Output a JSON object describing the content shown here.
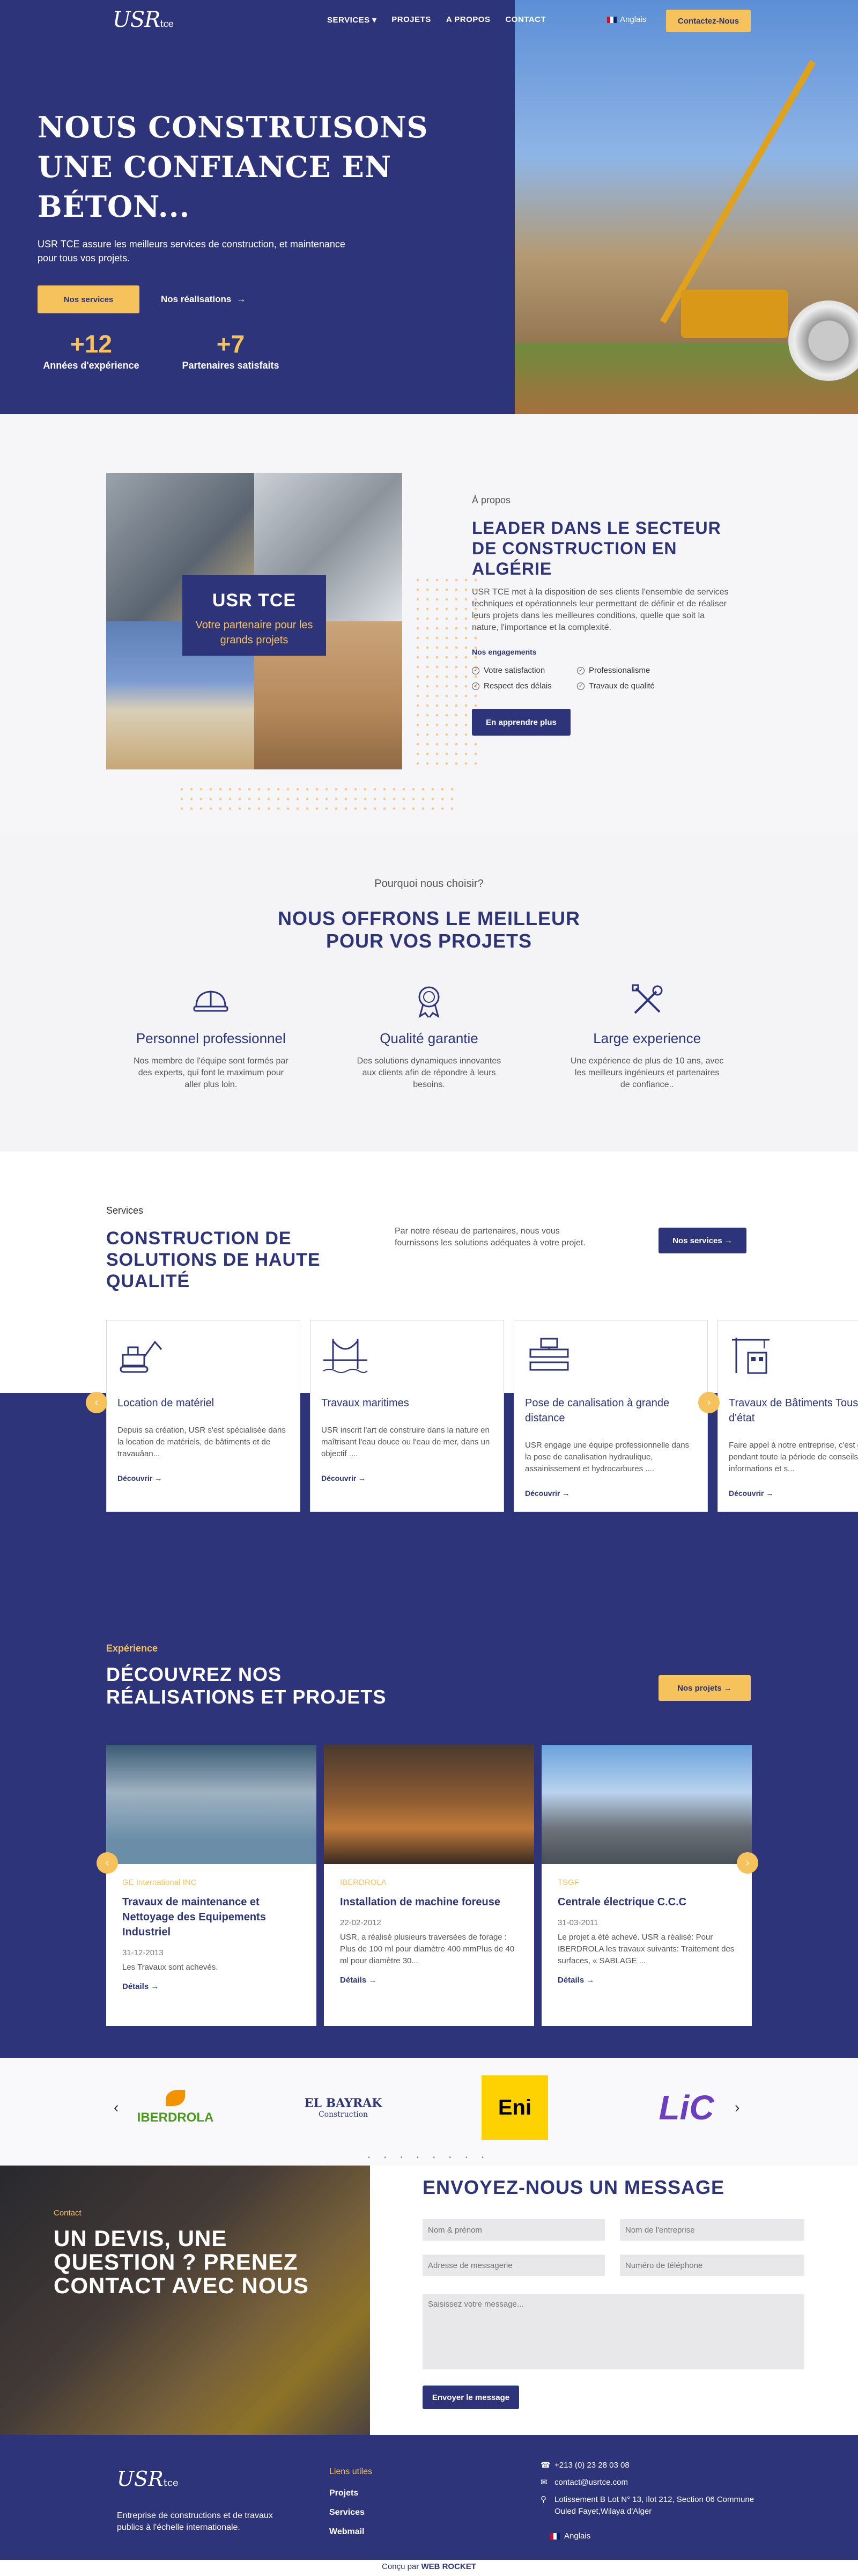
{
  "nav": {
    "logo": "USR",
    "logo_suffix": "tce",
    "items": [
      "SERVICES",
      "PROJETS",
      "A PROPOS",
      "CONTACT"
    ],
    "dropdown_arrow": "▾",
    "language": "Anglais",
    "cta": "Contactez-Nous"
  },
  "hero": {
    "title_line1": "NOUS CONSTRUISONS",
    "title_line2": "UNE CONFIANCE EN BÉTON...",
    "subtitle": "USR TCE assure les meilleurs services de construction, et maintenance pour tous vos projets.",
    "btn_services": "Nos services",
    "btn_realisations": "Nos réalisations",
    "stats": [
      {
        "value": "+12",
        "label": "Années d'expérience"
      },
      {
        "value": "+7",
        "label": "Partenaires satisfaits"
      }
    ]
  },
  "about": {
    "badge_title": "USR TCE",
    "badge_sub": "Votre partenaire pour les grands projets",
    "eyebrow": "À propos",
    "title": "LEADER DANS LE SECTEUR DE CONSTRUCTION EN ALGÉRIE",
    "text": "USR TCE met à la disposition de ses clients l'ensemble de services techniques et opérationnels leur permettant de définir et de réaliser leurs projets dans les meilleures conditions, quelle que soit la nature, l'importance et la complexité.",
    "engagements_title": "Nos engagements",
    "engagements": [
      "Votre satisfaction",
      "Professionalisme",
      "Respect des délais",
      "Travaux de qualité"
    ],
    "button": "En apprendre plus"
  },
  "why": {
    "eyebrow": "Pourquoi nous choisir?",
    "title_line1": "NOUS OFFRONS LE MEILLEUR",
    "title_line2": "POUR VOS PROJETS",
    "items": [
      {
        "title": "Personnel professionnel",
        "text": "Nos membre de l'équipe sont formés par des experts, qui font le maximum pour aller plus loin."
      },
      {
        "title": "Qualité garantie",
        "text": "Des solutions dynamiques innovantes aux clients afin de répondre à leurs besoins."
      },
      {
        "title": "Large experience",
        "text": "Une expérience de plus de 10 ans, avec les meilleurs ingénieurs et partenaires de confiance.."
      }
    ]
  },
  "services": {
    "eyebrow": "Services",
    "title": "CONSTRUCTION DE SOLUTIONS DE HAUTE QUALITÉ",
    "description": "Par notre réseau de partenaires, nous vous fournissons les solutions adéquates à votre projet.",
    "button": "Nos services",
    "cards": [
      {
        "title": "Location de matériel",
        "text": "Depuis sa création, USR s'est spécialisée dans la location de matériels, de bâtiments et de travauâan...",
        "more": "Découvrir"
      },
      {
        "title": "Travaux maritimes",
        "text": "USR inscrit l'art de construire dans la nature en maîtrisant l'eau douce ou l'eau de mer, dans un objectif ....",
        "more": "Découvrir"
      },
      {
        "title": "Pose de canalisation à grande distance",
        "text": "USR engage une équipe professionnelle dans la pose de canalisation hydraulique, assainissement et hydrocarbures ....",
        "more": "Découvrir"
      },
      {
        "title": "Travaux de Bâtiments Tous Corps d'état",
        "text": "Faire appel à notre entreprise, c'est être serein pendant toute la période de conseils, informations et s...",
        "more": "Découvrir"
      }
    ]
  },
  "projects": {
    "eyebrow": "Expérience",
    "title": "DÉCOUVREZ NOS RÉALISATIONS ET PROJETS",
    "button": "Nos projets",
    "cards": [
      {
        "client": "GE International INC",
        "title": "Travaux de maintenance et Nettoyage des Equipements Industriel",
        "date": "31-12-2013",
        "text": "Les Travaux sont achevés.",
        "more": "Détails"
      },
      {
        "client": "IBERDROLA",
        "title": "Installation de machine foreuse",
        "date": "22-02-2012",
        "text": "USR, a réalisé plusieurs traversées de forage : Plus de 100 ml pour diamètre 400 mmPlus de 40 ml pour diamètre 30...",
        "more": "Détails"
      },
      {
        "client": "TSGF",
        "title": "Centrale électrique C.C.C",
        "date": "31-03-2011",
        "text": "Le projet a été achevé. USR a réalisé: Pour IBERDROLA les travaux suivants: Traitement des surfaces, « SABLAGE ...",
        "more": "Détails"
      }
    ]
  },
  "partners": {
    "logos": [
      "IBERDROLA",
      "EL BAYRAK",
      "Construction",
      "Eni",
      "LiC"
    ],
    "prev": "‹",
    "next": "›",
    "dots": "• • • • • • • •"
  },
  "contact": {
    "eyebrow": "Contact",
    "title": "UN DEVIS, UNE QUESTION ? PRENEZ CONTACT AVEC NOUS",
    "form_title": "ENVOYEZ-NOUS UN MESSAGE",
    "fields": {
      "name": "Nom & prénom",
      "company": "Nom de l'entreprise",
      "email": "Adresse de messagerie",
      "phone": "Numéro de téléphone",
      "message": "Saisissez votre message..."
    },
    "button": "Envoyer le message"
  },
  "footer": {
    "logo": "USR",
    "logo_suffix": "tce",
    "description": "Entreprise de constructions et de travaux publics à l'échelle internationale.",
    "links_title": "Liens utiles",
    "links": [
      "Projets",
      "Services",
      "Webmail"
    ],
    "phone": "+213 (0) 23 28 03 08",
    "email": "contact@usrtce.com",
    "address": "Lotissement B Lot N° 13, Ilot 212, Section 06 Commune Ouled Fayet,Wilaya d'Alger",
    "language": "Anglais"
  },
  "copyright": {
    "prefix": "Conçu par",
    "brand": "WEB ROCKET"
  },
  "colors": {
    "navy": "#2d3479",
    "gold": "#f6c25b"
  }
}
